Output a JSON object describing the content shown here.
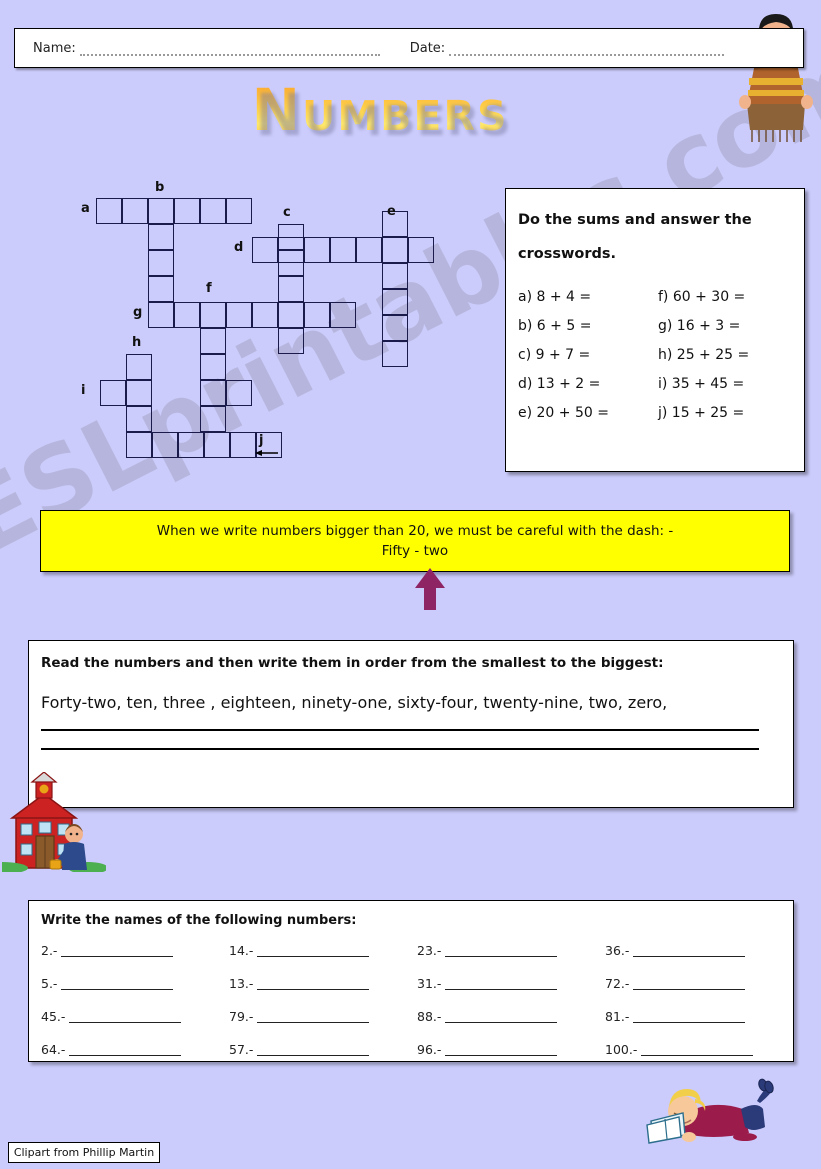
{
  "page": {
    "background_color": "#ccccfc",
    "watermark": "ESLprintables.com"
  },
  "header": {
    "name_label": "Name:",
    "date_label": "Date:"
  },
  "title": "Numbers",
  "crossword": {
    "clue_letters": [
      "a",
      "b",
      "c",
      "d",
      "e",
      "f",
      "g",
      "h",
      "i",
      "j"
    ],
    "arrow_direction": "left"
  },
  "sums": {
    "instructions_line1": "Do the sums and answer the",
    "instructions_line2": "crosswords.",
    "items": [
      "a) 8 + 4 =",
      "f) 60 + 30 =",
      "b) 6 + 5 =",
      "g) 16 + 3 =",
      "c) 9 + 7 =",
      "h) 25 + 25 =",
      "d) 13 + 2 =",
      "i) 35 + 45 =",
      "e) 20 + 50 =",
      "j) 15 + 25 ="
    ]
  },
  "banner": {
    "line1": "When we write numbers bigger than 20, we must be careful with the dash:  -",
    "line2": "Fifty  -  two",
    "background_color": "#ffff00",
    "arrow_color": "#8e2463"
  },
  "read_section": {
    "title": "Read the numbers and then write them in order from the smallest to the biggest:",
    "numbers": "Forty-two, ten, three , eighteen, ninety-one, sixty-four, twenty-nine, two, zero,",
    "answer_lines": 2
  },
  "names_section": {
    "title": "Write the names of the following numbers:",
    "items": [
      "2.-",
      "14.-",
      "23.-",
      "36.-",
      "5.-",
      "13.-",
      "31.-",
      "72.-",
      "45.-",
      "79.-",
      "88.-",
      "81.-",
      "64.-",
      "57.-",
      "96.-",
      "100.-"
    ]
  },
  "footer": {
    "credit": "Clipart from Phillip Martin"
  }
}
